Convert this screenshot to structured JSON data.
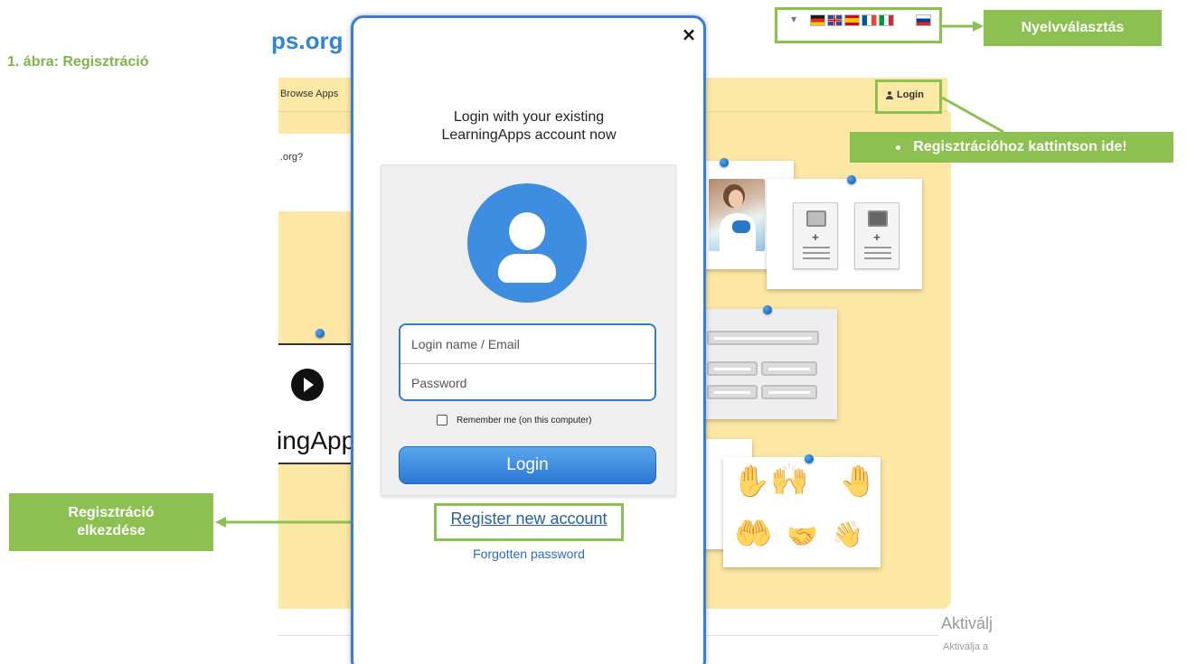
{
  "annotations": {
    "figure_title": "1. ábra: Regisztráció",
    "language_label": "Nyelvválasztás",
    "register_click_label": "Regisztrációhoz kattintson ide!",
    "register_start_line1": "Regisztráció",
    "register_start_line2": "elkezdése",
    "accent_color": "#8cc152"
  },
  "background_site": {
    "logo_fragment": "ps.org",
    "nav_browse_fragment": "Browse Apps",
    "login_button": "Login",
    "faq_fragment": ".org?",
    "video_brand_fragment": "ingApp",
    "flags": [
      "de-flag-icon",
      "gb-flag-icon",
      "es-flag-icon",
      "fr-flag-icon",
      "it-flag-icon",
      "ru-flag-icon"
    ]
  },
  "modal": {
    "heading_line1": "Login with your existing",
    "heading_line2": "LearningApps account now",
    "close_glyph": "×",
    "username_placeholder": "Login name / Email",
    "password_placeholder": "Password",
    "remember_label": "Remember me (on this computer)",
    "login_button": "Login",
    "register_link": "Register new account",
    "forgot_link": "Forgotten password",
    "accent_color": "#3a7cd6"
  },
  "watermark": {
    "line1": "Aktiválj",
    "line2": "Aktiválja a"
  }
}
